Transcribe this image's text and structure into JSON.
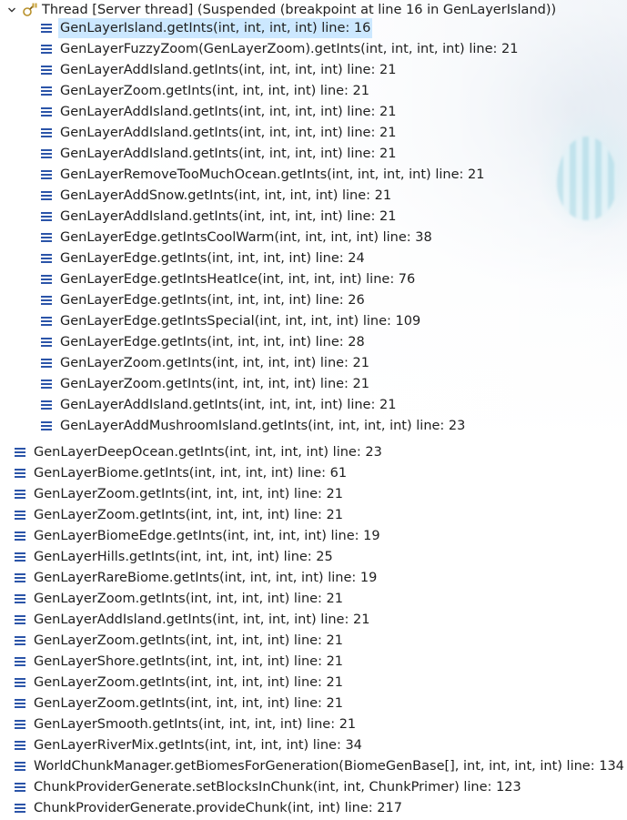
{
  "thread": {
    "label": "Thread [Server thread] (Suspended (breakpoint at line 16 in GenLayerIsland))",
    "expanded": true
  },
  "frames_nested": [
    {
      "label": "GenLayerIsland.getInts(int, int, int, int) line: 16",
      "selected": true
    },
    {
      "label": "GenLayerFuzzyZoom(GenLayerZoom).getInts(int, int, int, int) line: 21"
    },
    {
      "label": "GenLayerAddIsland.getInts(int, int, int, int) line: 21"
    },
    {
      "label": "GenLayerZoom.getInts(int, int, int, int) line: 21"
    },
    {
      "label": "GenLayerAddIsland.getInts(int, int, int, int) line: 21"
    },
    {
      "label": "GenLayerAddIsland.getInts(int, int, int, int) line: 21"
    },
    {
      "label": "GenLayerAddIsland.getInts(int, int, int, int) line: 21"
    },
    {
      "label": "GenLayerRemoveTooMuchOcean.getInts(int, int, int, int) line: 21"
    },
    {
      "label": "GenLayerAddSnow.getInts(int, int, int, int) line: 21"
    },
    {
      "label": "GenLayerAddIsland.getInts(int, int, int, int) line: 21"
    },
    {
      "label": "GenLayerEdge.getIntsCoolWarm(int, int, int, int) line: 38"
    },
    {
      "label": "GenLayerEdge.getInts(int, int, int, int) line: 24"
    },
    {
      "label": "GenLayerEdge.getIntsHeatIce(int, int, int, int) line: 76"
    },
    {
      "label": "GenLayerEdge.getInts(int, int, int, int) line: 26"
    },
    {
      "label": "GenLayerEdge.getIntsSpecial(int, int, int, int) line: 109"
    },
    {
      "label": "GenLayerEdge.getInts(int, int, int, int) line: 28"
    },
    {
      "label": "GenLayerZoom.getInts(int, int, int, int) line: 21"
    },
    {
      "label": "GenLayerZoom.getInts(int, int, int, int) line: 21"
    },
    {
      "label": "GenLayerAddIsland.getInts(int, int, int, int) line: 21"
    },
    {
      "label": "GenLayerAddMushroomIsland.getInts(int, int, int, int) line: 23"
    }
  ],
  "frames_outer": [
    {
      "label": "GenLayerDeepOcean.getInts(int, int, int, int) line: 23"
    },
    {
      "label": "GenLayerBiome.getInts(int, int, int, int) line: 61"
    },
    {
      "label": "GenLayerZoom.getInts(int, int, int, int) line: 21"
    },
    {
      "label": "GenLayerZoom.getInts(int, int, int, int) line: 21"
    },
    {
      "label": "GenLayerBiomeEdge.getInts(int, int, int, int) line: 19"
    },
    {
      "label": "GenLayerHills.getInts(int, int, int, int) line: 25"
    },
    {
      "label": "GenLayerRareBiome.getInts(int, int, int, int) line: 19"
    },
    {
      "label": "GenLayerZoom.getInts(int, int, int, int) line: 21"
    },
    {
      "label": "GenLayerAddIsland.getInts(int, int, int, int) line: 21"
    },
    {
      "label": "GenLayerZoom.getInts(int, int, int, int) line: 21"
    },
    {
      "label": "GenLayerShore.getInts(int, int, int, int) line: 21"
    },
    {
      "label": "GenLayerZoom.getInts(int, int, int, int) line: 21"
    },
    {
      "label": "GenLayerZoom.getInts(int, int, int, int) line: 21"
    },
    {
      "label": "GenLayerSmooth.getInts(int, int, int, int) line: 21"
    },
    {
      "label": "GenLayerRiverMix.getInts(int, int, int, int) line: 34"
    },
    {
      "label": "WorldChunkManager.getBiomesForGeneration(BiomeGenBase[], int, int, int, int) line: 134"
    },
    {
      "label": "ChunkProviderGenerate.setBlocksInChunk(int, int, ChunkPrimer) line: 123"
    },
    {
      "label": "ChunkProviderGenerate.provideChunk(int, int) line: 217"
    }
  ],
  "colors": {
    "selection": "#cce8ff",
    "frame_icon": "#2b54a8",
    "thread_icon": "#c8a23a"
  },
  "icons": {
    "twisty": "chevron-down-icon",
    "thread": "thread-suspended-icon",
    "frame": "stack-frame-icon"
  }
}
